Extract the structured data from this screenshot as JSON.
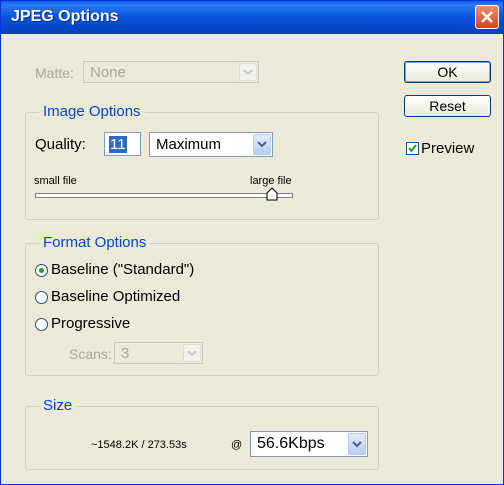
{
  "window": {
    "title": "JPEG Options"
  },
  "matte": {
    "label": "Matte:",
    "value": "None"
  },
  "buttons": {
    "ok": "OK",
    "reset": "Reset"
  },
  "preview": {
    "label": "Preview",
    "checked": true
  },
  "image_options": {
    "legend": "Image Options",
    "quality_label": "Quality:",
    "quality_value": "11",
    "quality_preset": "Maximum",
    "slider_min_label": "small file",
    "slider_max_label": "large file",
    "slider_level_fraction": 0.92
  },
  "format_options": {
    "legend": "Format Options",
    "options": [
      "Baseline (\"Standard\")",
      "Baseline Optimized",
      "Progressive"
    ],
    "selected_index": 0,
    "scans_label": "Scans:",
    "scans_value": "3"
  },
  "size": {
    "legend": "Size",
    "estimate": "~1548.2K / 273.53s",
    "at": "@",
    "speed": "56.6Kbps"
  },
  "colors": {
    "title_bar": "#0a58df",
    "legend_text": "#0046d5",
    "dialog_bg": "#ece9d8",
    "selection": "#316ac5"
  }
}
